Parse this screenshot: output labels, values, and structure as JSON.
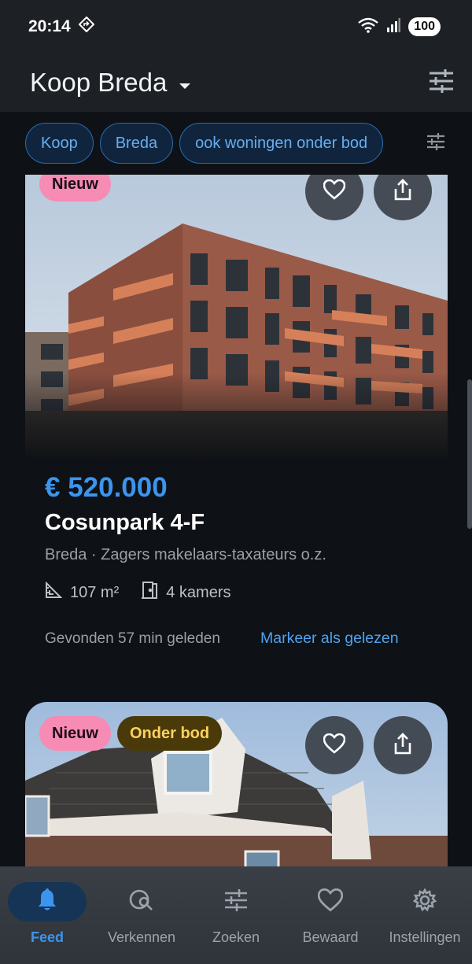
{
  "status": {
    "time": "20:14",
    "battery": "100"
  },
  "app_bar": {
    "title": "Koop Breda"
  },
  "chips": [
    "Koop",
    "Breda",
    "ook woningen onder bod"
  ],
  "listings": [
    {
      "badges": [
        "Nieuw"
      ],
      "price": "€ 520.000",
      "address": "Cosunpark 4-F",
      "meta": "Breda · Zagers makelaars-taxateurs o.z.",
      "area": "107 m²",
      "rooms": "4 kamers",
      "found": "Gevonden 57 min geleden",
      "mark_read": "Markeer als gelezen"
    },
    {
      "badges": [
        "Nieuw",
        "Onder bod"
      ]
    }
  ],
  "nav": [
    {
      "label": "Feed",
      "icon": "bell-icon",
      "active": true
    },
    {
      "label": "Verkennen",
      "icon": "explore-search-icon"
    },
    {
      "label": "Zoeken",
      "icon": "sliders-icon"
    },
    {
      "label": "Bewaard",
      "icon": "heart-icon"
    },
    {
      "label": "Instellingen",
      "icon": "gear-icon"
    }
  ],
  "colors": {
    "accent": "#3c94ec",
    "badge_new": "#f68bb4",
    "badge_bid": "#ffd25f"
  }
}
